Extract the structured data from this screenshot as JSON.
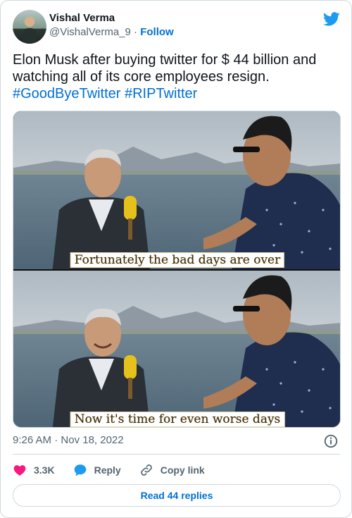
{
  "author": {
    "display_name": "Vishal Verma",
    "handle": "@VishalVerma_9",
    "separator": "·",
    "follow_label": "Follow"
  },
  "tweet": {
    "text": "Elon Musk after buying twitter for $ 44 billion and watching all of its core employees resign.",
    "hashtags": [
      "#GoodByeTwitter",
      "#RIPTwitter"
    ]
  },
  "media": {
    "top_caption": "Fortunately the bad days are over",
    "bottom_caption": "Now it's time for even worse days"
  },
  "meta": {
    "time": "9:26 AM",
    "separator": "·",
    "date": "Nov 18, 2022"
  },
  "actions": {
    "likes": "3.3K",
    "reply_label": "Reply",
    "copy_label": "Copy link"
  },
  "read_replies_label": "Read 44 replies",
  "colors": {
    "link": "#006fd6",
    "twitter_blue": "#1d9bf0",
    "like_red": "#f91880",
    "secondary_text": "#536471",
    "border": "#cfd9de"
  },
  "icons": {
    "brand": "twitter-bird-icon",
    "info": "info-icon",
    "like": "heart-icon",
    "reply": "speech-bubble-icon",
    "copy": "link-icon"
  }
}
